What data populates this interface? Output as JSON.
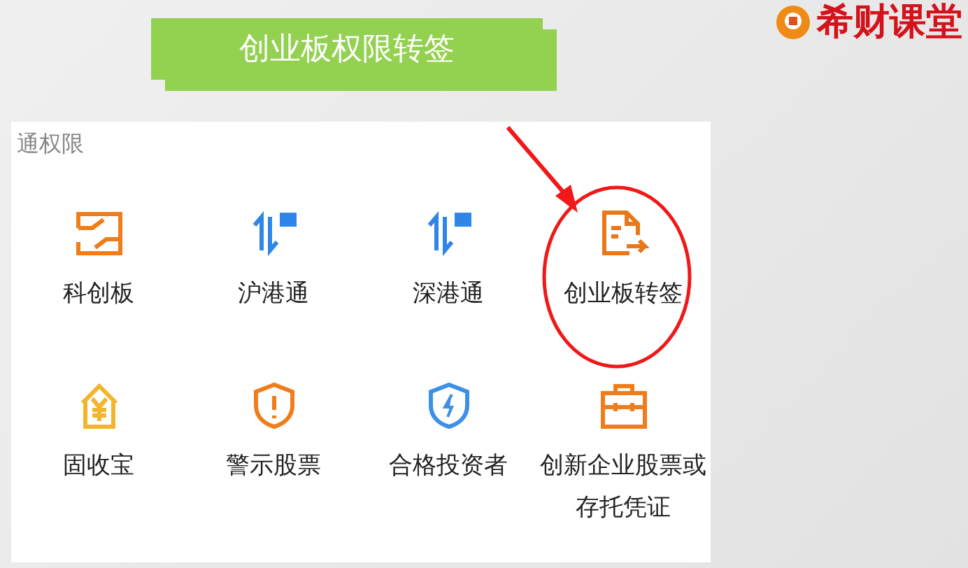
{
  "slide_title": "创业板权限转签",
  "logo": {
    "text": "希财课堂"
  },
  "panel": {
    "header": "通权限",
    "items": [
      {
        "label": "科创板",
        "circled": false
      },
      {
        "label": "沪港通",
        "circled": false
      },
      {
        "label": "深港通",
        "circled": false
      },
      {
        "label": "创业板转签",
        "circled": true
      },
      {
        "label": "固收宝",
        "circled": false
      },
      {
        "label": "警示股票",
        "circled": false
      },
      {
        "label": "合格投资者",
        "circled": false
      },
      {
        "label": "创新企业股票或存托凭证",
        "circled": false
      }
    ]
  }
}
